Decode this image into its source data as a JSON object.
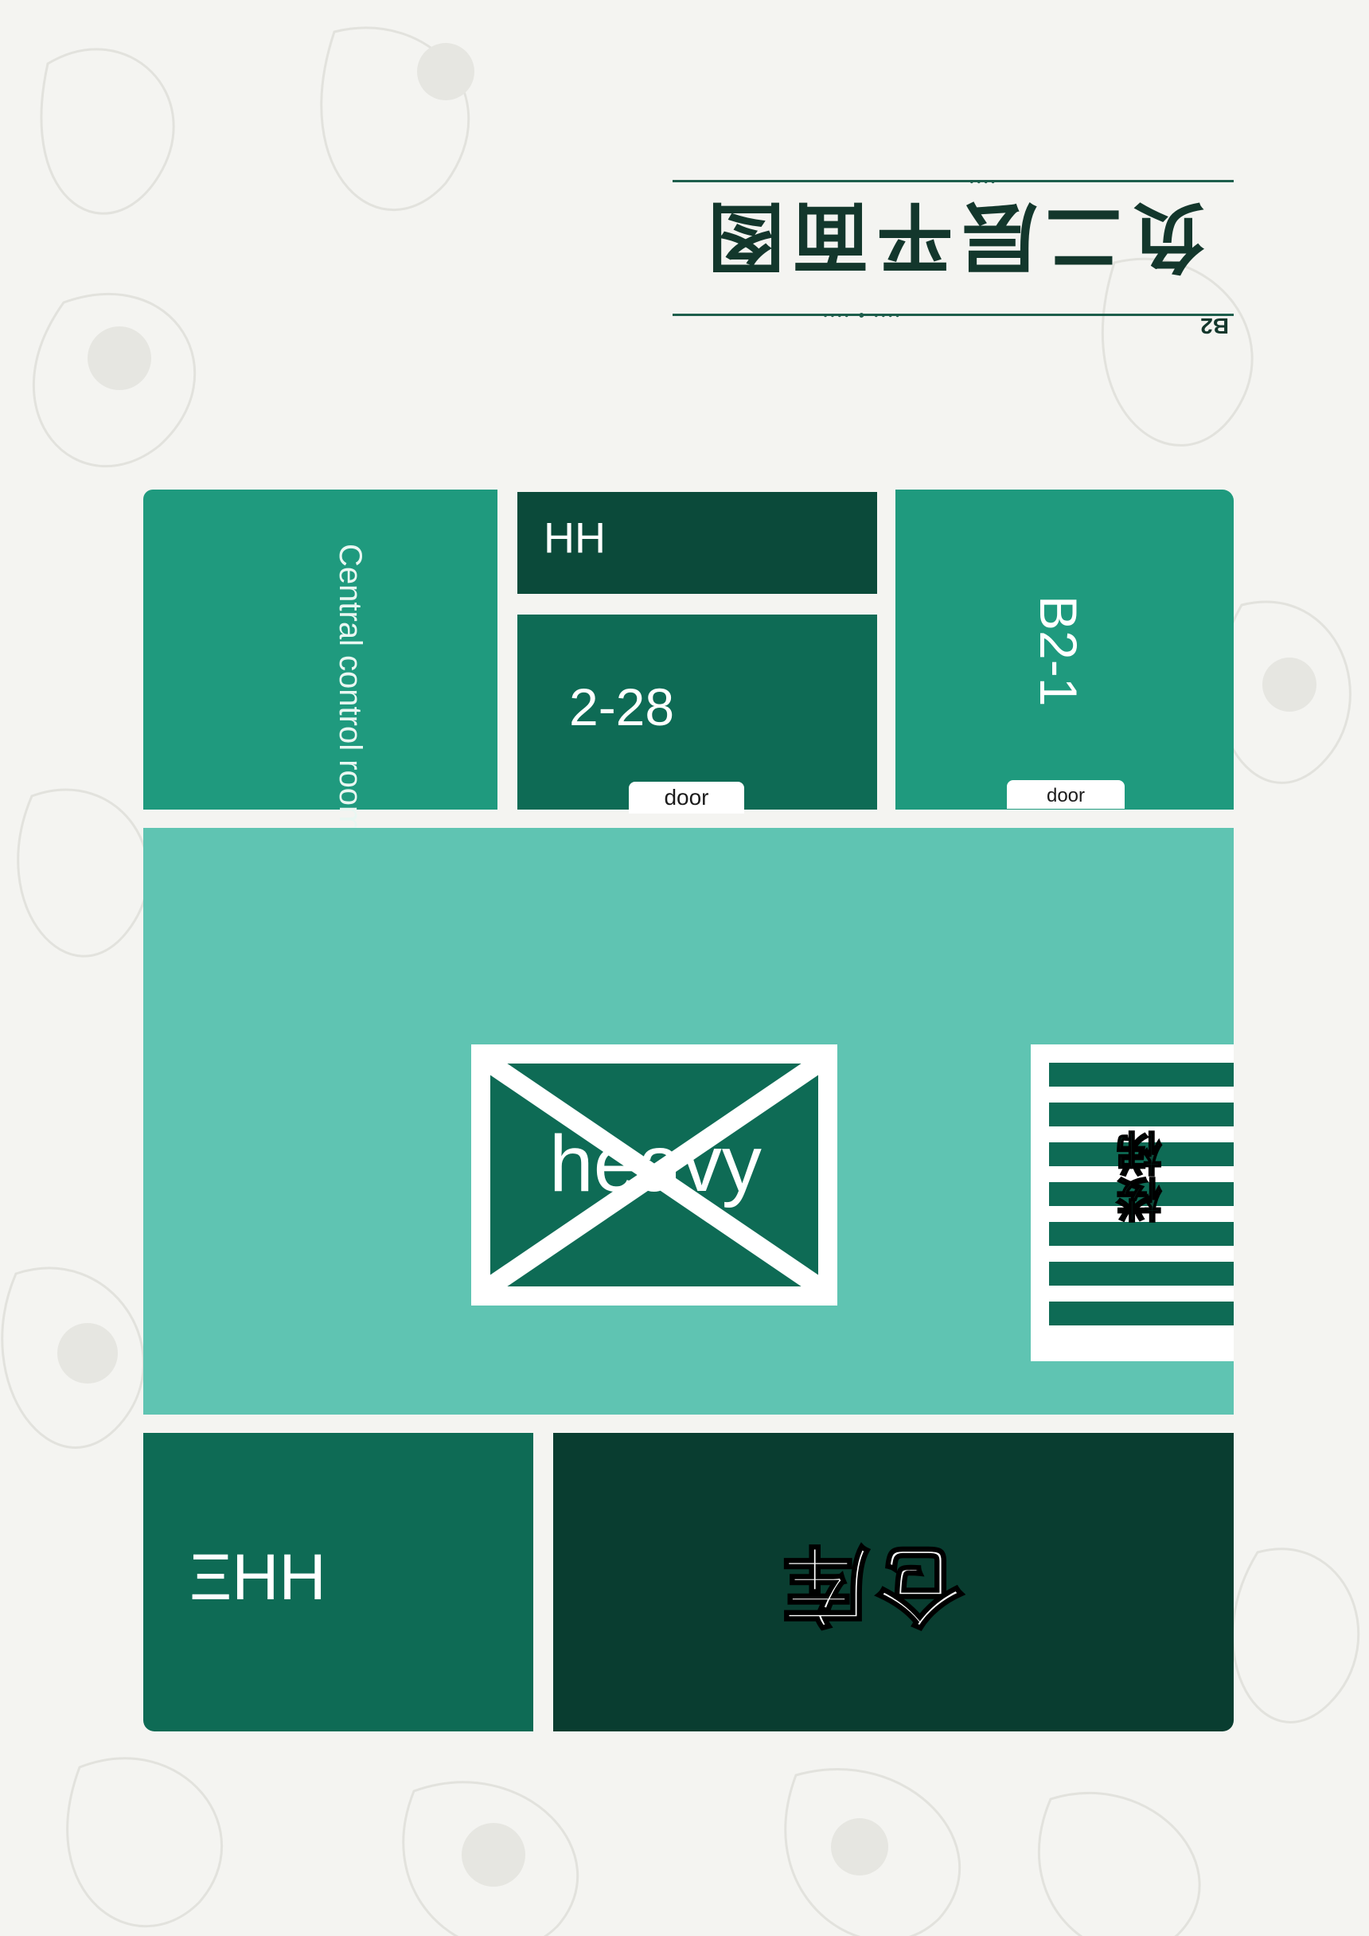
{
  "header": {
    "title": "负二层平面图",
    "floor_code": "B2"
  },
  "rooms": {
    "central_control_room": {
      "label": "Central control room"
    },
    "hh_top": {
      "label": "HH"
    },
    "room_228": {
      "label": "2-28",
      "door": "door"
    },
    "room_b21": {
      "label": "B2-1",
      "door": "door"
    },
    "elevator": {
      "label": "heavy"
    },
    "stairs": {
      "label": "楼梯"
    },
    "bottom_left": {
      "label": "ΞHH"
    },
    "warehouse": {
      "label": "仓库"
    }
  },
  "colors": {
    "room_mid": "#1f9a7e",
    "room_dark": "#0e6b55",
    "room_darkest": "#093d30",
    "hall": "#5fc4b2"
  }
}
